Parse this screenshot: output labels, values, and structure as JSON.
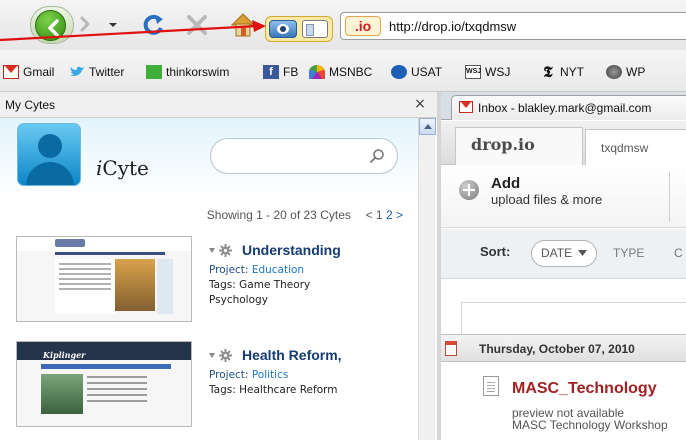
{
  "browser": {
    "url": "http://drop.io/txqdmsw",
    "site_identity": ".io",
    "buttons": {
      "back": "back",
      "forward": "forward",
      "reload": "reload",
      "stop": "stop",
      "home": "home"
    }
  },
  "bookmarks": [
    {
      "label": "Gmail",
      "icon": "gmail-icon"
    },
    {
      "label": "Twitter",
      "icon": "twitter-icon"
    },
    {
      "label": "thinkorswim",
      "icon": "thinkorswim-icon"
    },
    {
      "label": "FB",
      "icon": "facebook-icon"
    },
    {
      "label": "MSNBC",
      "icon": "msnbc-icon"
    },
    {
      "label": "USAT",
      "icon": "usat-icon"
    },
    {
      "label": "WSJ",
      "icon": "wsj-icon"
    },
    {
      "label": "NYT",
      "icon": "nyt-icon"
    },
    {
      "label": "WP",
      "icon": "wp-icon"
    }
  ],
  "sidebar": {
    "title": "My Cytes",
    "close": "×",
    "brand": "Cyte",
    "brand_prefix": "i",
    "showing": "Showing 1 - 20 of 23 Cytes",
    "pager_prev": "<",
    "pager_current": "1",
    "pager_next_page": "2",
    "pager_next": ">",
    "cytes": [
      {
        "title": "Understanding",
        "project_label": "Project:",
        "project": "Education",
        "tags_label": "Tags:",
        "tags_line1": "Game Theory",
        "tags_line2": "Psychology"
      },
      {
        "title": "Health Reform,",
        "project_label": "Project:",
        "project": "Politics",
        "tags_label": "Tags:",
        "tags_line1": "Healthcare Reform",
        "thumb_logo": "Kiplinger"
      }
    ]
  },
  "content": {
    "tab_title": "Inbox - blakley.mark@gmail.com",
    "dropio_logo": "drop.io",
    "drop_name": "txqdmsw",
    "add_label": "Add",
    "add_sub": "upload files & more",
    "sort_label": "Sort:",
    "sort_selected": "DATE",
    "sort_type": "TYPE",
    "sort_more": "C",
    "date_header": "Thursday, October 07, 2010",
    "file_name": "MASC_Technology",
    "file_preview": "preview not available",
    "file_desc": "MASC Technology Workshop"
  },
  "colors": {
    "accent_red": "#d72f24",
    "cyte_title": "#143b72",
    "file_name": "#a02222"
  }
}
